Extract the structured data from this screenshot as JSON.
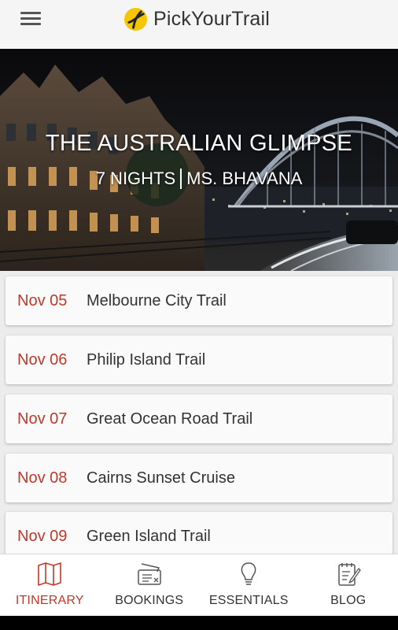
{
  "header": {
    "brand_name": "PickYourTrail",
    "menu_icon": "hamburger-menu-icon",
    "logo_icon": "pickyourtrail-logo-icon"
  },
  "hero": {
    "title": "THE AUSTRALIAN GLIMPSE",
    "nights": "7 NIGHTS",
    "traveller": "MS. BHAVANA"
  },
  "itinerary": [
    {
      "date": "Nov 05",
      "name": "Melbourne City Trail"
    },
    {
      "date": "Nov 06",
      "name": "Philip Island Trail"
    },
    {
      "date": "Nov 07",
      "name": "Great Ocean Road Trail"
    },
    {
      "date": "Nov 08",
      "name": "Cairns Sunset Cruise"
    },
    {
      "date": "Nov 09",
      "name": "Green Island Trail"
    }
  ],
  "bottom_nav": [
    {
      "label": "ITINERARY",
      "icon": "map-icon",
      "active": true
    },
    {
      "label": "BOOKINGS",
      "icon": "ticket-icon",
      "active": false
    },
    {
      "label": "ESSENTIALS",
      "icon": "lightbulb-icon",
      "active": false
    },
    {
      "label": "BLOG",
      "icon": "notepad-icon",
      "active": false
    }
  ],
  "colors": {
    "accent": "#c0392b",
    "logo_yellow": "#f6c600",
    "header_bg": "#f5f5f5",
    "list_bg": "#ececec"
  }
}
